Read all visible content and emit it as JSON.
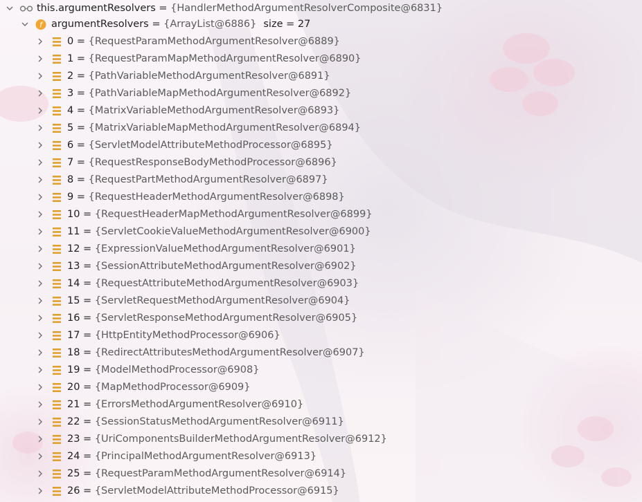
{
  "root": {
    "name": "this.argumentResolvers",
    "op": " = ",
    "value": "{HandlerMethodArgumentResolverComposite@6831}",
    "icon": "watch-glasses-icon"
  },
  "field": {
    "name": "argumentResolvers",
    "op": " = ",
    "value": "{ArrayList@6886}",
    "size": "size = 27",
    "icon_letter": "f",
    "icon": "field-icon"
  },
  "items": [
    {
      "idx": "0",
      "value": "{RequestParamMethodArgumentResolver@6889}"
    },
    {
      "idx": "1",
      "value": "{RequestParamMapMethodArgumentResolver@6890}"
    },
    {
      "idx": "2",
      "value": "{PathVariableMethodArgumentResolver@6891}"
    },
    {
      "idx": "3",
      "value": "{PathVariableMapMethodArgumentResolver@6892}"
    },
    {
      "idx": "4",
      "value": "{MatrixVariableMethodArgumentResolver@6893}"
    },
    {
      "idx": "5",
      "value": "{MatrixVariableMapMethodArgumentResolver@6894}"
    },
    {
      "idx": "6",
      "value": "{ServletModelAttributeMethodProcessor@6895}"
    },
    {
      "idx": "7",
      "value": "{RequestResponseBodyMethodProcessor@6896}"
    },
    {
      "idx": "8",
      "value": "{RequestPartMethodArgumentResolver@6897}"
    },
    {
      "idx": "9",
      "value": "{RequestHeaderMethodArgumentResolver@6898}"
    },
    {
      "idx": "10",
      "value": "{RequestHeaderMapMethodArgumentResolver@6899}"
    },
    {
      "idx": "11",
      "value": "{ServletCookieValueMethodArgumentResolver@6900}"
    },
    {
      "idx": "12",
      "value": "{ExpressionValueMethodArgumentResolver@6901}"
    },
    {
      "idx": "13",
      "value": "{SessionAttributeMethodArgumentResolver@6902}"
    },
    {
      "idx": "14",
      "value": "{RequestAttributeMethodArgumentResolver@6903}"
    },
    {
      "idx": "15",
      "value": "{ServletRequestMethodArgumentResolver@6904}"
    },
    {
      "idx": "16",
      "value": "{ServletResponseMethodArgumentResolver@6905}"
    },
    {
      "idx": "17",
      "value": "{HttpEntityMethodProcessor@6906}"
    },
    {
      "idx": "18",
      "value": "{RedirectAttributesMethodArgumentResolver@6907}"
    },
    {
      "idx": "19",
      "value": "{ModelMethodProcessor@6908}"
    },
    {
      "idx": "20",
      "value": "{MapMethodProcessor@6909}"
    },
    {
      "idx": "21",
      "value": "{ErrorsMethodArgumentResolver@6910}"
    },
    {
      "idx": "22",
      "value": "{SessionStatusMethodArgumentResolver@6911}"
    },
    {
      "idx": "23",
      "value": "{UriComponentsBuilderMethodArgumentResolver@6912}"
    },
    {
      "idx": "24",
      "value": "{PrincipalMethodArgumentResolver@6913}"
    },
    {
      "idx": "25",
      "value": "{RequestParamMethodArgumentResolver@6914}"
    },
    {
      "idx": "26",
      "value": "{ServletModelAttributeMethodProcessor@6915}"
    }
  ],
  "item_op": " = ",
  "item_icon": "list-element-icon",
  "colors": {
    "chevron": "#6e6e6e",
    "field_icon_bg": "#f0a732",
    "element_icon": "#e0a030",
    "value_text": "#5a5a5a",
    "name_text": "#1e1e1e"
  }
}
